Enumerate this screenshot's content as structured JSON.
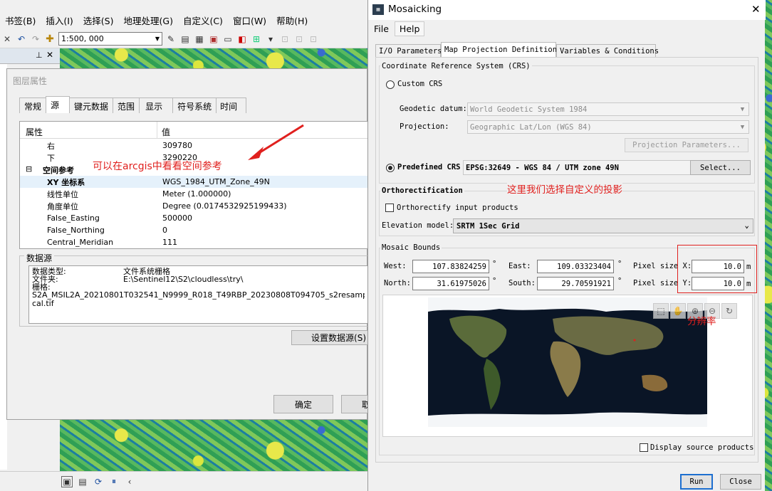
{
  "arcgis": {
    "menu": [
      "书签(B)",
      "插入(I)",
      "选择(S)",
      "地理处理(G)",
      "自定义(C)",
      "窗口(W)",
      "帮助(H)"
    ],
    "scale": "1:500, 000"
  },
  "layer_dialog": {
    "title": "图层属性",
    "tabs": [
      "常规",
      "源",
      "键元数据",
      "范围",
      "显示",
      "符号系统",
      "时间"
    ],
    "active_tab": "源",
    "header": {
      "property": "属性",
      "value": "值"
    },
    "rows": [
      {
        "key": "右",
        "value": "309780"
      },
      {
        "key": "下",
        "value": "3290220"
      },
      {
        "key": "空间参考",
        "value": ""
      },
      {
        "key": "XY 坐标系",
        "value": "WGS_1984_UTM_Zone_49N"
      },
      {
        "key": "线性单位",
        "value": "Meter (1.000000)"
      },
      {
        "key": "角度单位",
        "value": "Degree (0.0174532925199433)"
      },
      {
        "key": "False_Easting",
        "value": "500000"
      },
      {
        "key": "False_Northing",
        "value": "0"
      },
      {
        "key": "Central_Meridian",
        "value": "111"
      }
    ],
    "collapse_glyph": "⊟",
    "annotation": "可以在arcgis中看看空间参考",
    "datasource_label": "数据源",
    "datasource": {
      "type_label": "数据类型:",
      "type_value": "文件系统栅格",
      "folder_label": "文件夹:",
      "folder_value": "E:\\Sentinel12\\S2\\cloudless\\try\\",
      "name_label": "栅格:",
      "name_line1": "S2A_MSIL2A_20210801T032541_N9999_R018_T49RBP_20230808T094705_s2resampled_msk_bic",
      "name_line2": "cal.tif"
    },
    "set_source_button": "设置数据源(S)",
    "ok_button": "确定",
    "cancel_button": "取"
  },
  "mosaic": {
    "title": "Mosaicking",
    "menu": [
      "File",
      "Help"
    ],
    "tabs": [
      "I/O Parameters",
      "Map Projection Definition",
      "Variables & Conditions"
    ],
    "active_tab": "Map Projection Definition",
    "crs": {
      "group_label": "Coordinate Reference System (CRS)",
      "custom_label": "Custom CRS",
      "datum_label": "Geodetic datum:",
      "datum_value": "World Geodetic System 1984",
      "projection_label": "Projection:",
      "projection_value": "Geographic Lat/Lon (WGS 84)",
      "proj_params_button": "Projection Parameters...",
      "predefined_label": "Predefined CRS",
      "predefined_value": "EPSG:32649 - WGS 84 / UTM zone 49N",
      "select_button": "Select...",
      "selected": "predefined"
    },
    "annotation_crs": "这里我们选择自定义的投影",
    "ortho": {
      "group_label": "Orthorectification",
      "checkbox_label": "Orthorectify input products",
      "checked": false,
      "elevation_label": "Elevation model:",
      "elevation_value": "SRTM 1Sec Grid"
    },
    "bounds": {
      "group_label": "Mosaic Bounds",
      "west_label": "West:",
      "west": "107.83824259",
      "east_label": "East:",
      "east": "109.03323404",
      "north_label": "North:",
      "north": "31.61975026",
      "south_label": "South:",
      "south": "29.70591921",
      "pixel_x_label": "Pixel size X:",
      "pixel_x": "10.0",
      "pixel_y_label": "Pixel size Y:",
      "pixel_y": "10.0",
      "unit_deg": "°",
      "unit_m": "m"
    },
    "annotation_res": "分辨率",
    "display_source_label": "Display source products",
    "run_button": "Run",
    "close_button": "Close"
  }
}
